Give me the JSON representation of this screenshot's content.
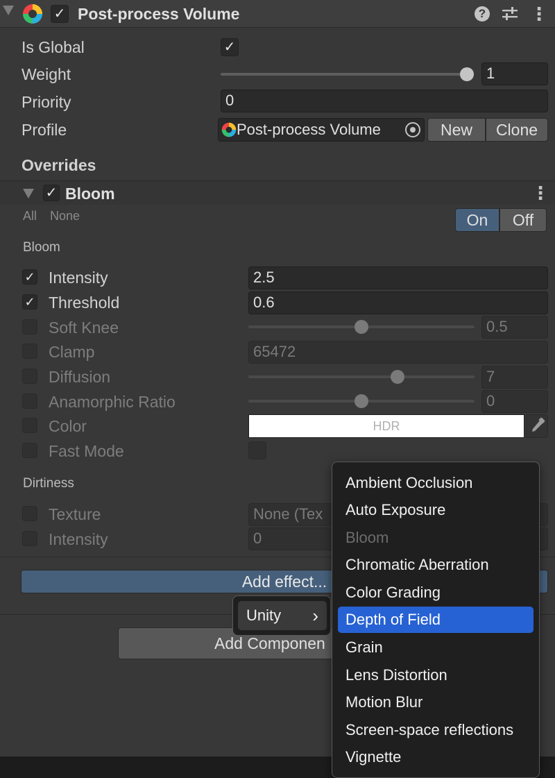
{
  "component": {
    "title": "Post-process Volume",
    "enabled_check": "✓",
    "help_icon": "?",
    "settings_icon": "⚙",
    "more_icon": "⋮"
  },
  "volume": {
    "is_global_label": "Is Global",
    "is_global_check": "✓",
    "weight_label": "Weight",
    "weight_value": "1",
    "weight_level": 1.0,
    "priority_label": "Priority",
    "priority_value": "0",
    "profile_label": "Profile",
    "profile_value": "Post-process Volume",
    "new_label": "New",
    "clone_label": "Clone"
  },
  "overrides": {
    "heading": "Overrides",
    "effect_title": "Bloom",
    "effect_check": "✓",
    "all_label": "All",
    "none_label": "None",
    "on_label": "On",
    "off_label": "Off"
  },
  "bloom": {
    "section_label": "Bloom",
    "intensity_label": "Intensity",
    "intensity_value": "2.5",
    "threshold_label": "Threshold",
    "threshold_value": "0.6",
    "soft_knee_label": "Soft Knee",
    "soft_knee_value": "0.5",
    "soft_knee_level": 0.5,
    "clamp_label": "Clamp",
    "clamp_value": "65472",
    "diffusion_label": "Diffusion",
    "diffusion_value": "7",
    "anamorphic_label": "Anamorphic Ratio",
    "anamorphic_value": "0",
    "color_label": "Color",
    "color_value": "HDR",
    "color_swatch": "#ffffff",
    "fast_mode_label": "Fast Mode",
    "checked_mark": "✓"
  },
  "dirtiness": {
    "section_label": "Dirtiness",
    "texture_label": "Texture",
    "texture_value": "None (Tex",
    "intensity_label": "Intensity",
    "intensity_value": "0"
  },
  "actions": {
    "add_effect_label": "Add effect...",
    "add_component_label": "Add Componen"
  },
  "submenu": {
    "item_label": "Unity",
    "arrow": "›"
  },
  "effect_menu": {
    "items": [
      {
        "label": "Ambient Occlusion"
      },
      {
        "label": "Auto Exposure"
      },
      {
        "label": "Bloom"
      },
      {
        "label": "Chromatic Aberration"
      },
      {
        "label": "Color Grading"
      },
      {
        "label": "Depth of Field"
      },
      {
        "label": "Grain"
      },
      {
        "label": "Lens Distortion"
      },
      {
        "label": "Motion Blur"
      },
      {
        "label": "Screen-space reflections"
      },
      {
        "label": "Vignette"
      }
    ],
    "selected": "Depth of Field",
    "disabled": "Bloom"
  },
  "colors": {
    "accent": "#2762d4",
    "toggle_on": "#46607c",
    "add_effect_bar": "#46607c"
  }
}
